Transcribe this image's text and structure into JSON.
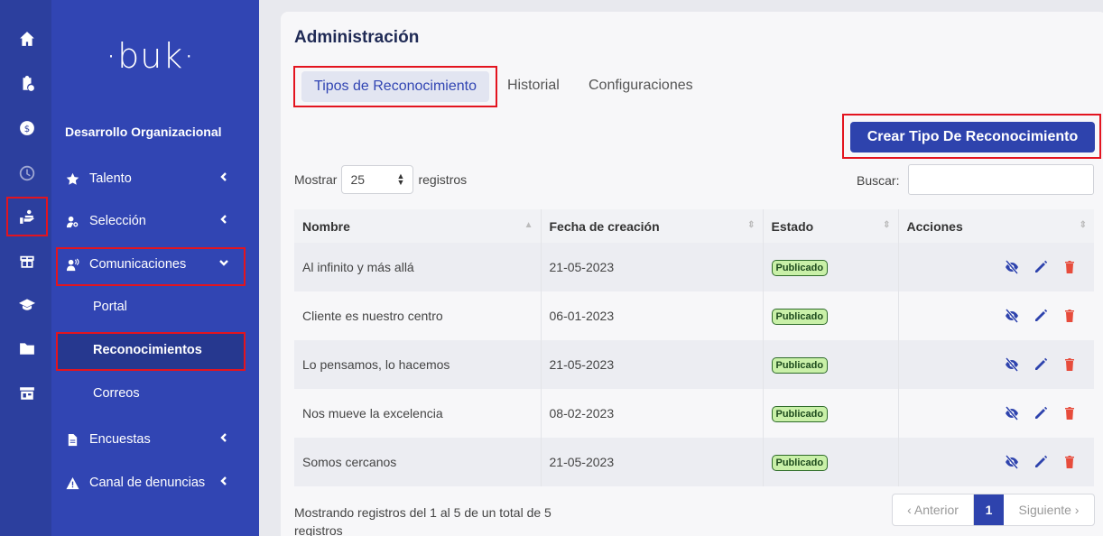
{
  "rail": {
    "items": [
      "home-icon",
      "clipboard-clock-icon",
      "dollar-coin-icon",
      "clock-icon",
      "hand-holding-people-icon",
      "gift-icon",
      "graduation-cap-icon",
      "folder-icon",
      "store-icon"
    ]
  },
  "sidebar": {
    "logo": "·buk·",
    "section_title": "Desarrollo Organizacional",
    "items": [
      {
        "label": "Talento",
        "icon": "star-icon"
      },
      {
        "label": "Selección",
        "icon": "user-search-icon"
      },
      {
        "label": "Comunicaciones",
        "icon": "user-voice-icon"
      },
      {
        "label": "Encuestas",
        "icon": "document-icon"
      },
      {
        "label": "Canal de denuncias",
        "icon": "warning-icon"
      }
    ],
    "sub_items": [
      "Portal",
      "Reconocimientos",
      "Correos"
    ]
  },
  "main": {
    "title": "Administración",
    "tabs": [
      "Tipos de Reconocimiento",
      "Historial",
      "Configuraciones"
    ],
    "create_button": "Crear Tipo De Reconocimiento",
    "show_label": "Mostrar",
    "show_value": "25",
    "records_label": "registros",
    "search_label": "Buscar:",
    "search_value": "",
    "columns": [
      "Nombre",
      "Fecha de creación",
      "Estado",
      "Acciones"
    ],
    "rows": [
      {
        "name": "Al infinito y más allá",
        "date": "21-05-2023",
        "status": "Publicado"
      },
      {
        "name": "Cliente es nuestro centro",
        "date": "06-01-2023",
        "status": "Publicado"
      },
      {
        "name": "Lo pensamos, lo hacemos",
        "date": "21-05-2023",
        "status": "Publicado"
      },
      {
        "name": "Nos mueve la excelencia",
        "date": "08-02-2023",
        "status": "Publicado"
      },
      {
        "name": "Somos cercanos",
        "date": "21-05-2023",
        "status": "Publicado"
      }
    ],
    "info": "Mostrando registros del 1 al 5 de un total de 5 registros",
    "pagination": {
      "prev": "‹ Anterior",
      "current": "1",
      "next": "Siguiente ›"
    }
  },
  "colors": {
    "primary": "#2e43ad",
    "sidebar": "#3145b3",
    "rail": "#2c3f9e",
    "highlight": "#e3141f",
    "badge_bg": "#c9f0a8",
    "delete": "#e74c3c"
  }
}
